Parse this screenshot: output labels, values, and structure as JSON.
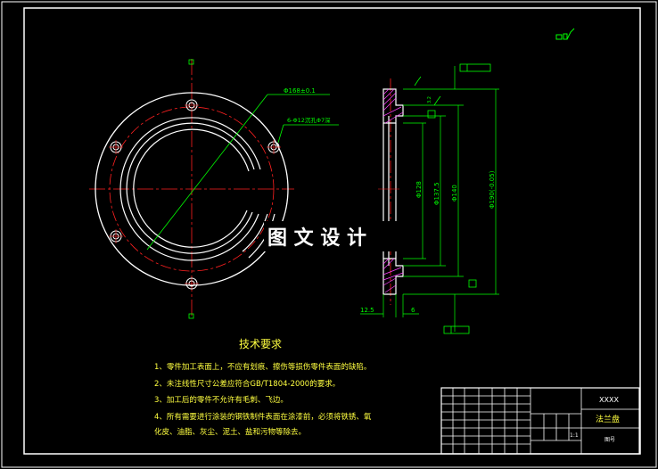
{
  "watermark": "图 文 设 计",
  "front_view": {
    "dim_pitch_circle": "Φ168±0.1",
    "dim_holes": "6-Φ12沉孔Φ7深"
  },
  "section_view": {
    "dim_d128": "Φ128",
    "dim_d137": "Φ137.5",
    "dim_d140": "Φ140",
    "dim_d190": "Φ190(-0.05)",
    "dim_width_total": "12.5",
    "dim_width_small": "6",
    "roughness_label": "3.2"
  },
  "tech_requirements": {
    "title": "技术要求",
    "items": [
      "1、零件加工表面上，不应有划痕、擦伤等损伤零件表面的缺陷。",
      "2、未注线性尺寸公差应符合GB/T1804-2000的要求。",
      "3、加工后的零件不允许有毛刺、飞边。",
      "4、所有需要进行涂装的钢铁制件表面在涂漆前，必须将铁锈、氧",
      "化皮、油脂、灰尘、泥土、盐和污物等除去。"
    ]
  },
  "title_block": {
    "company": "XXXX",
    "part_name": "法兰盘",
    "scale": "1:1",
    "sheet": "图号"
  },
  "colors": {
    "background": "#000000",
    "outline": "#ffffff",
    "centerline": "#ff2020",
    "dimension": "#00ff00",
    "section_hatch": "#ff40ff",
    "border": "#ffffff"
  }
}
